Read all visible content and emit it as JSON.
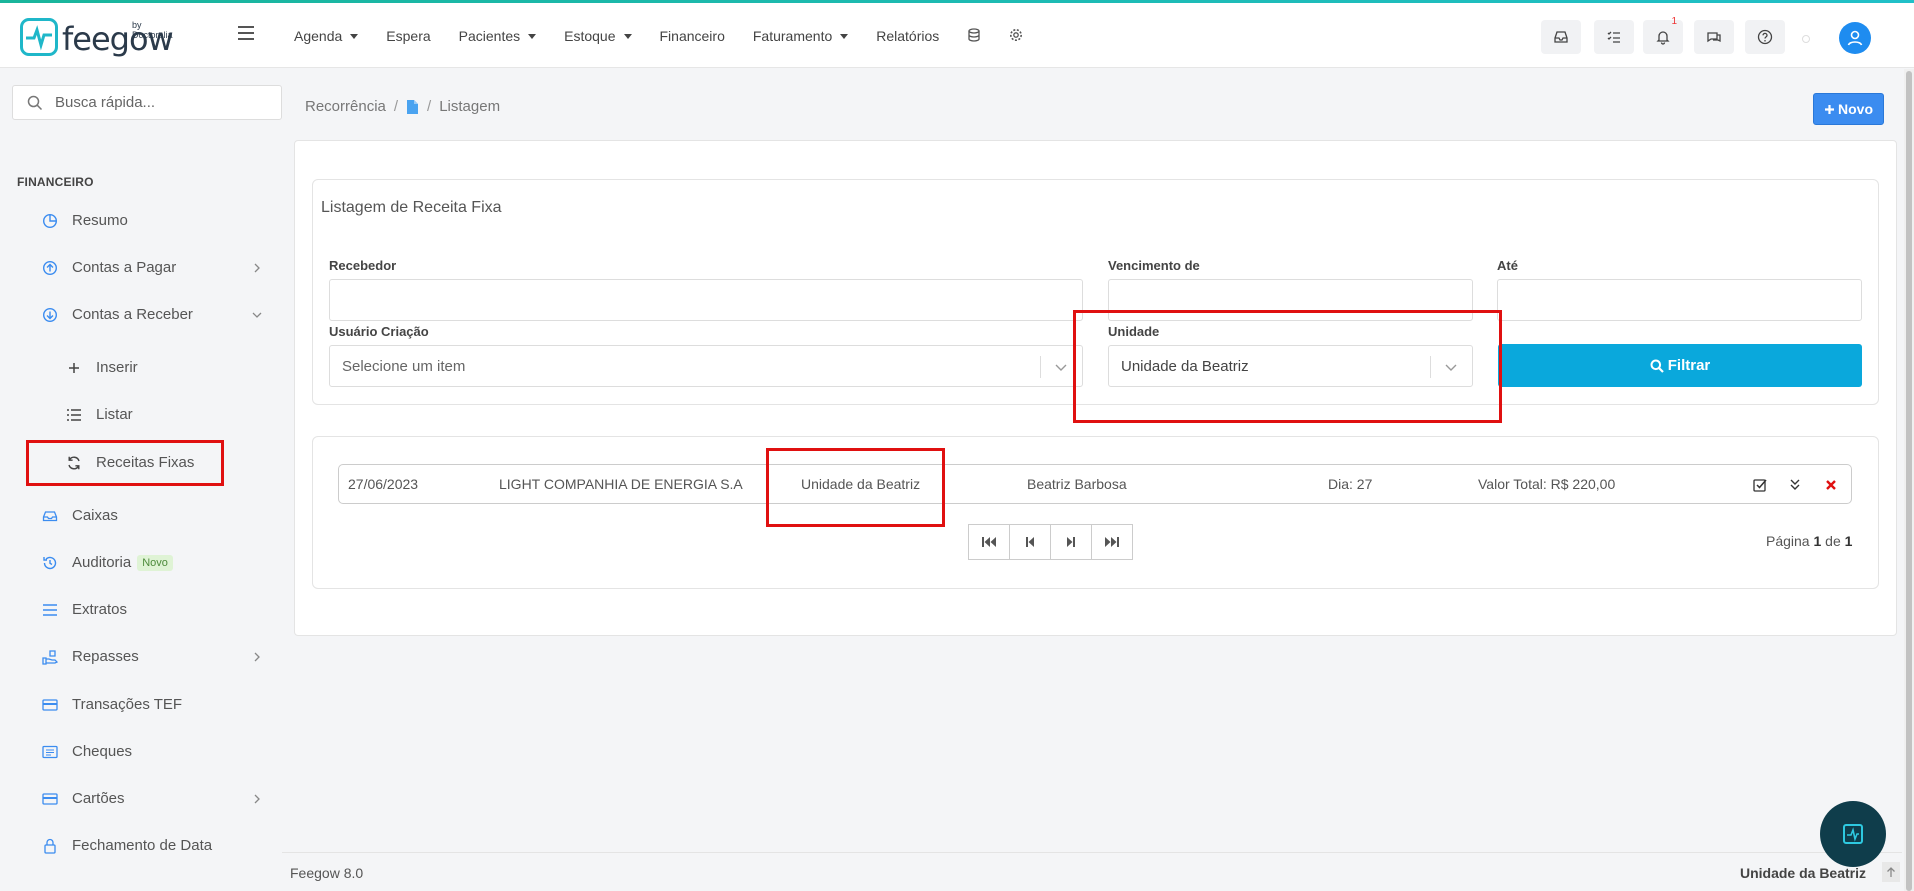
{
  "brand": {
    "name": "feegow",
    "by": "by Doctoralia"
  },
  "nav": [
    {
      "label": "Agenda",
      "dropdown": true
    },
    {
      "label": "Espera",
      "dropdown": false
    },
    {
      "label": "Pacientes",
      "dropdown": true
    },
    {
      "label": "Estoque",
      "dropdown": true
    },
    {
      "label": "Financeiro",
      "dropdown": false
    },
    {
      "label": "Faturamento",
      "dropdown": true
    },
    {
      "label": "Relatórios",
      "dropdown": false
    }
  ],
  "topbar": {
    "notification_count": "1"
  },
  "search": {
    "placeholder": "Busca rápida..."
  },
  "sidebar": {
    "section": "FINANCEIRO",
    "items": [
      {
        "label": "Resumo"
      },
      {
        "label": "Contas a Pagar"
      },
      {
        "label": "Contas a Receber"
      },
      {
        "label": "Inserir"
      },
      {
        "label": "Listar"
      },
      {
        "label": "Receitas Fixas"
      },
      {
        "label": "Caixas"
      },
      {
        "label": "Auditoria",
        "badge": "Novo"
      },
      {
        "label": "Extratos"
      },
      {
        "label": "Repasses"
      },
      {
        "label": "Transações TEF"
      },
      {
        "label": "Cheques"
      },
      {
        "label": "Cartões"
      },
      {
        "label": "Fechamento de Data"
      }
    ]
  },
  "breadcrumb": {
    "root": "Recorrência",
    "current": "Listagem"
  },
  "novo_button": "Novo",
  "filter": {
    "title": "Listagem de Receita Fixa",
    "recebedor_label": "Recebedor",
    "vencimento_label": "Vencimento de",
    "ate_label": "Até",
    "usuario_label": "Usuário Criação",
    "usuario_placeholder": "Selecione um item",
    "unidade_label": "Unidade",
    "unidade_value": "Unidade da Beatriz",
    "filtrar": "Filtrar"
  },
  "result": {
    "date": "27/06/2023",
    "recebedor": "LIGHT COMPANHIA DE ENERGIA S.A",
    "unidade": "Unidade da Beatriz",
    "usuario": "Beatriz Barbosa",
    "dia": "Dia: 27",
    "valor": "Valor Total: R$ 220,00"
  },
  "pagination": {
    "prefix": "Página ",
    "current": "1",
    "middle": " de ",
    "total": "1"
  },
  "footer": {
    "version": "Feegow 8.0",
    "unit": "Unidade da Beatriz"
  },
  "colors": {
    "primary": "#3b8cf0",
    "filter": "#0aa8dc",
    "highlight": "#e01010",
    "brand": "#1fb7c9"
  }
}
